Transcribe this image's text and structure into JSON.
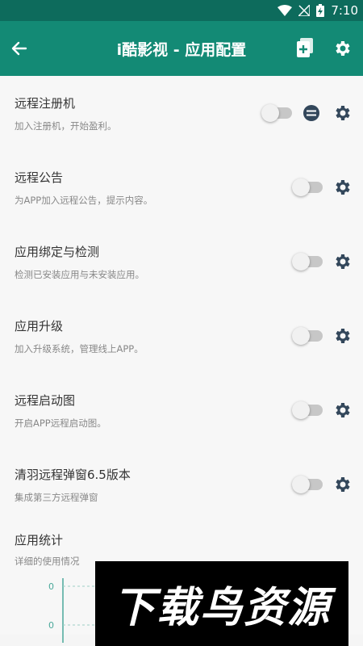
{
  "status_bar": {
    "time": "7:10"
  },
  "toolbar": {
    "title": "i酷影视 - 应用配置"
  },
  "items": [
    {
      "title": "远程注册机",
      "subtitle": "加入注册机，开始盈利。",
      "enabled": false
    },
    {
      "title": "远程公告",
      "subtitle": "为APP加入远程公告，提示内容。",
      "enabled": false
    },
    {
      "title": "应用绑定与检测",
      "subtitle": "检测已安装应用与未安装应用。",
      "enabled": false
    },
    {
      "title": "应用升级",
      "subtitle": "加入升级系统，管理线上APP。",
      "enabled": false
    },
    {
      "title": "远程启动图",
      "subtitle": "开启APP远程启动图。",
      "enabled": false
    },
    {
      "title": "清羽远程弹窗6.5版本",
      "subtitle": "集成第三方远程弹窗",
      "enabled": false
    }
  ],
  "stats": {
    "title": "应用统计",
    "subtitle": "详细的使用情况"
  },
  "chart_data": {
    "type": "line",
    "y_tick_labels": [
      "0",
      "0"
    ]
  },
  "watermark": "下载鸟资源",
  "colors": {
    "toolbar": "#138a75",
    "status_bar": "#0d6b5c"
  }
}
